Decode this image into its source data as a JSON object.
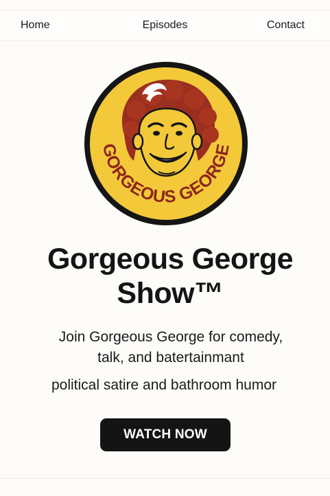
{
  "nav": {
    "home": "Home",
    "episodes": "Episodes",
    "contact": "Contact"
  },
  "logo": {
    "text": "GORGEOUS GEORGE",
    "colors": {
      "ring": "#151515",
      "fill": "#f3c93a",
      "hair": "#9a2e1f",
      "text": "#8e2618"
    }
  },
  "hero": {
    "title_line1": "Gorgeous George",
    "title_line2": "Show™",
    "tagline_line1": "Join Gorgeous George for comedy,",
    "tagline_line2": "talk, and batertainmant",
    "subline": "political satire and bathroom humor",
    "cta_label": "WATCH NOW"
  },
  "colors": {
    "background": "#fdfcf9",
    "button": "#141414",
    "button_text": "#ffffff"
  }
}
